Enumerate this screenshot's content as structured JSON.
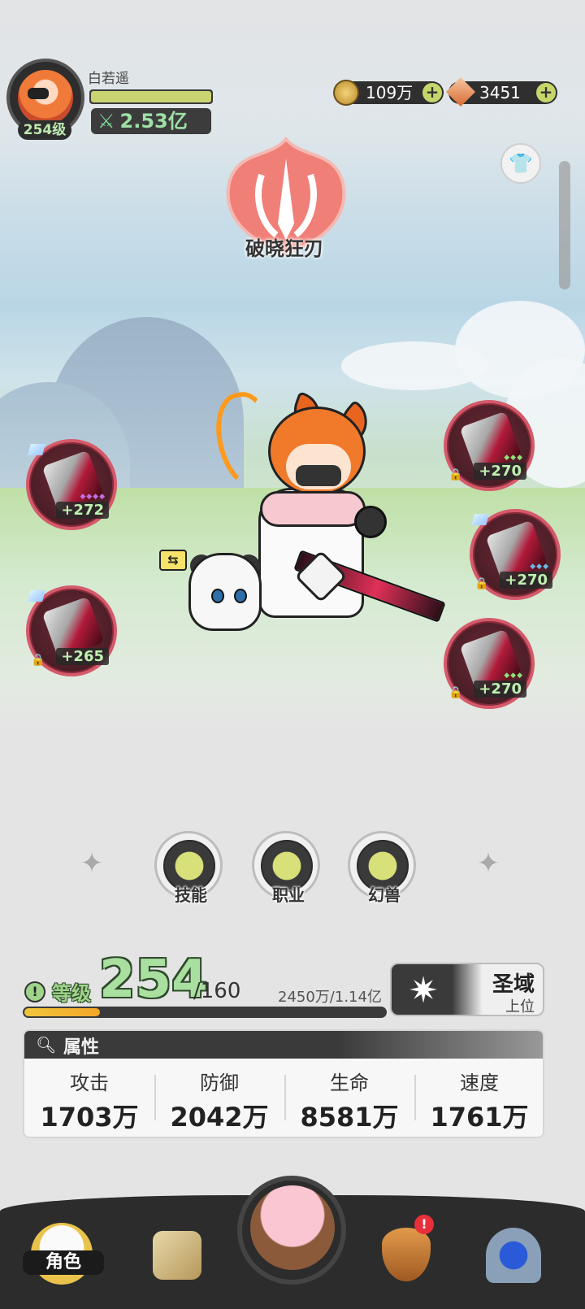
{
  "player": {
    "name": "白若遥",
    "level_badge": "254级",
    "power": "2.53亿"
  },
  "currency": {
    "gold": "109万",
    "gems": "3451"
  },
  "title": {
    "name": "破晓狂刃"
  },
  "equipment": {
    "left": [
      {
        "value": "+272"
      },
      {
        "value": "+265"
      }
    ],
    "right": [
      {
        "value": "+270"
      },
      {
        "value": "+270"
      },
      {
        "value": "+270"
      }
    ]
  },
  "features": [
    {
      "label": "技能",
      "icon": "skill-icon"
    },
    {
      "label": "职业",
      "icon": "class-icon"
    },
    {
      "label": "幻兽",
      "icon": "beast-icon"
    }
  ],
  "level": {
    "label": "等级",
    "current": "254",
    "max": "/160",
    "exp_text": "2450万/1.14亿",
    "exp_progress": 0.21
  },
  "rank": {
    "name": "圣域",
    "sub": "上位"
  },
  "attributes": {
    "title": "属性",
    "items": [
      {
        "key": "攻击",
        "value": "1703万"
      },
      {
        "key": "防御",
        "value": "2042万"
      },
      {
        "key": "生命",
        "value": "8581万"
      },
      {
        "key": "速度",
        "value": "1761万"
      }
    ]
  },
  "nav": {
    "active_label": "角色",
    "alert": "!"
  },
  "colors": {
    "accent_green": "#9fd48a",
    "exp_orange": "#f3a62a",
    "slot_border": "#d45a6a"
  }
}
